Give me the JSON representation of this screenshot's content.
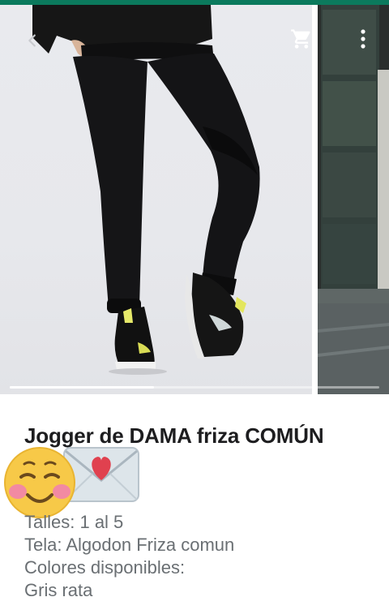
{
  "topbar": {
    "back_icon": "chevron-left-icon",
    "cart_icon": "cart-icon",
    "more_icon": "more-vertical-icon"
  },
  "carousel": {
    "slides": [
      {
        "alt": "joggers-photo"
      },
      {
        "alt": "building-photo"
      }
    ],
    "progress": 0.39
  },
  "product": {
    "title": "Jogger de DAMA friza COMÚN",
    "emojis": [
      "envelope-heart-icon",
      "smiling-face-icon"
    ],
    "description": [
      "Talles: 1 al 5",
      "Tela: Algodon Friza comun",
      "Colores disponibles:",
      "Gris rata"
    ]
  },
  "colors": {
    "accent": "#0b7a5d",
    "text_muted": "#6a6f73"
  }
}
